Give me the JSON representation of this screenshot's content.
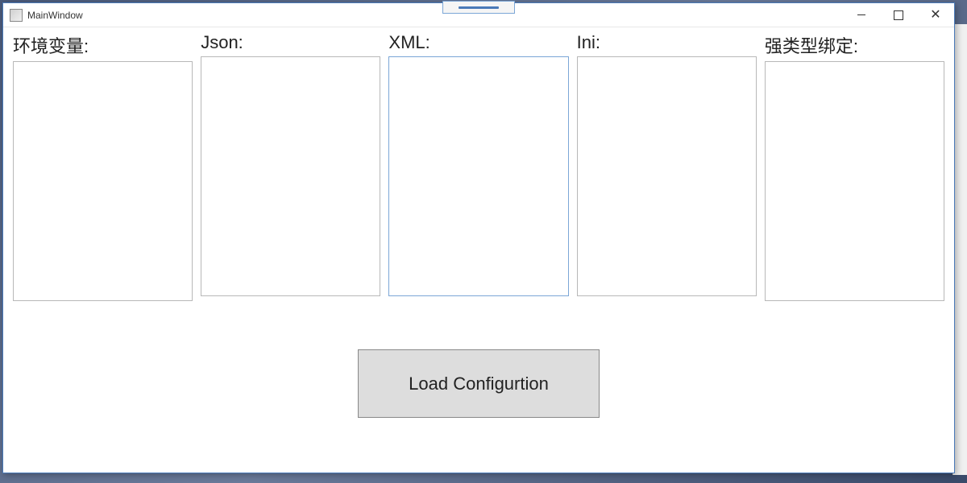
{
  "window": {
    "title": "MainWindow"
  },
  "columns": [
    {
      "label": "环境变量:",
      "value": "",
      "active": false
    },
    {
      "label": "Json:",
      "value": "",
      "active": false
    },
    {
      "label": "XML:",
      "value": "",
      "active": true
    },
    {
      "label": "Ini:",
      "value": "",
      "active": false
    },
    {
      "label": "强类型绑定:",
      "value": "",
      "active": false
    }
  ],
  "actions": {
    "load_button_label": "Load Configurtion"
  }
}
